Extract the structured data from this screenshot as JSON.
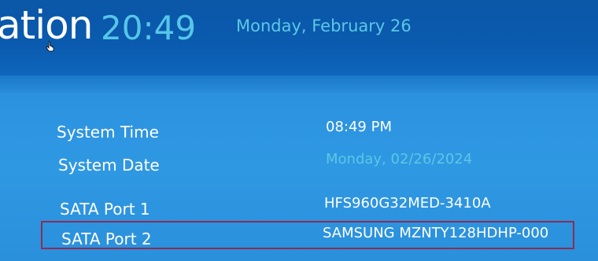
{
  "header": {
    "title_fragment": "ation",
    "clock": "20:49",
    "date": "Monday, February 26"
  },
  "rows": [
    {
      "label": "System Time",
      "value": "08:49 PM"
    },
    {
      "label": "System Date",
      "value": "Monday, 02/26/2024"
    },
    {
      "label": "SATA Port 1",
      "value": "HFS960G32MED-3410A"
    },
    {
      "label": "SATA Port 2",
      "value": "SAMSUNG MZNTY128HDHP-000"
    }
  ],
  "colors": {
    "header_bg": "#0b57a8",
    "panel_bg": "#2b92df",
    "accent_cyan": "#56c6e8",
    "selection_border": "#8d2d54"
  },
  "icons": {
    "cursor": "hand-pointer-icon"
  }
}
